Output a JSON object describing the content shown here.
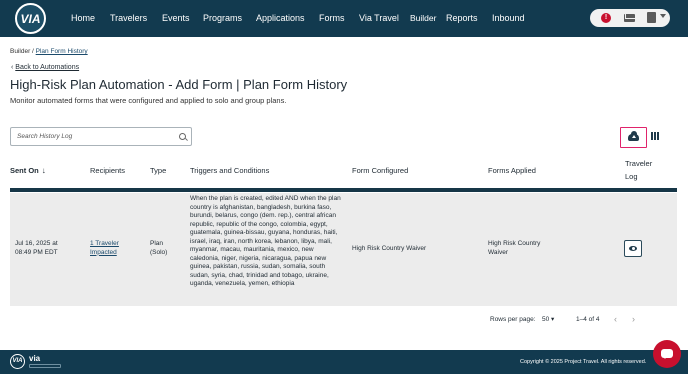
{
  "nav": {
    "logo_text": "VIA",
    "items": [
      "Home",
      "Travelers",
      "Events",
      "Programs",
      "Applications",
      "Forms",
      "Via Travel",
      "Builder",
      "Reports",
      "Inbound"
    ],
    "alert_badge": "!",
    "icons": [
      "alert-icon",
      "mail-icon",
      "clipboard-icon",
      "chevron-down-icon"
    ]
  },
  "breadcrumb": {
    "root": "Builder",
    "separator": " / ",
    "current": "Plan Form History"
  },
  "back_link": "Back to Automations",
  "page": {
    "title": "High-Risk Plan Automation - Add Form | Plan Form History",
    "subtitle": "Monitor automated forms that were configured and applied to solo and group plans."
  },
  "search": {
    "placeholder": "Search History Log"
  },
  "toolbar": {
    "export_icon": "cloud-download-icon",
    "columns_icon": "columns-icon",
    "highlight_color": "#e0236b"
  },
  "table": {
    "columns": [
      "Sent On",
      "Recipients",
      "Type",
      "Triggers and Conditions",
      "Form Configured",
      "Forms Applied",
      "Traveler",
      "Log"
    ],
    "rows": [
      {
        "sent_on_date": "Jul 16, 2025 at",
        "sent_on_time": "08:49 PM EDT",
        "recipients_line1": "1 Traveler",
        "recipients_line2": "Impacted",
        "type_line1": "Plan",
        "type_line2": "(Solo)",
        "triggers": "When the plan is created, edited AND when the plan country is afghanistan, bangladesh, burkina faso, burundi, belarus, congo (dem. rep.), central african republic, republic of the congo, colombia, egypt, guatemala, guinea-bissau, guyana, honduras, haiti, israel, iraq, iran, north korea, lebanon, libya, mali, myanmar, macau, mauritania, mexico, new caledonia, niger, nigeria, nicaragua, papua new guinea, pakistan, russia, sudan, somalia, south sudan, syria, chad, trinidad and tobago, ukraine, uganda, venezuela, yemen, ethiopia",
        "form_configured": "High Risk Country Waiver",
        "forms_applied_line1": "High Risk Country",
        "forms_applied_line2": "Waiver"
      }
    ]
  },
  "pagination": {
    "rows_label": "Rows per page:",
    "rows_value": "50",
    "range": "1–4 of 4",
    "prev": "‹",
    "next": "›"
  },
  "footer": {
    "logo_text": "VIA",
    "brand": "via",
    "copyright": "Copyright © 2025 Project Travel. All rights reserved."
  },
  "colors": {
    "nav_bg": "#123a4f",
    "accent": "#e0236b",
    "alert": "#c8102e",
    "row_bg": "#ececec"
  }
}
